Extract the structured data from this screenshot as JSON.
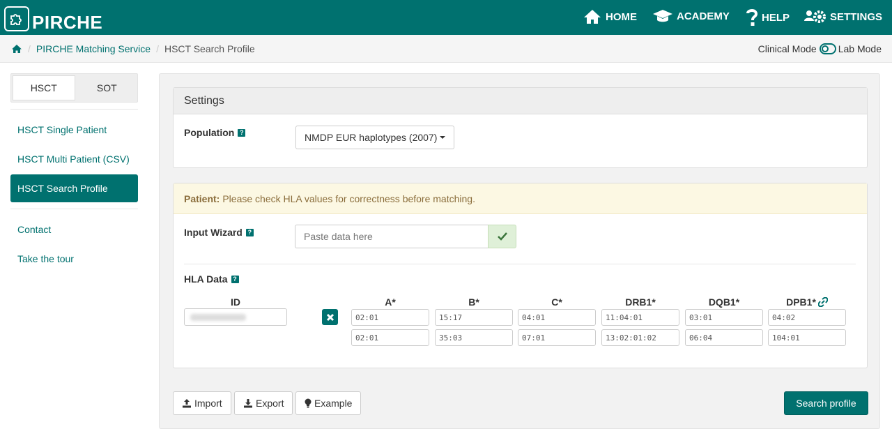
{
  "brand": {
    "name": "PIRCHE",
    "logo_icon": "puzzle-icon"
  },
  "nav": [
    {
      "label": "HOME",
      "icon": "home-icon"
    },
    {
      "label": "ACADEMY",
      "icon": "graduation-cap-icon"
    },
    {
      "label": "HELP",
      "icon": "question-icon"
    },
    {
      "label": "SETTINGS",
      "icon": "users-cog-icon"
    }
  ],
  "breadcrumb": {
    "home_icon": "home-icon",
    "items": [
      "PIRCHE Matching Service",
      "HSCT Search Profile"
    ],
    "separator": "/"
  },
  "mode": {
    "left_label": "Clinical Mode",
    "right_label": "Lab Mode"
  },
  "sidebar": {
    "tabs": [
      "HSCT",
      "SOT"
    ],
    "active_tab": "HSCT",
    "links": [
      "HSCT Single Patient",
      "HSCT Multi Patient (CSV)",
      "HSCT Search Profile"
    ],
    "active_link": "HSCT Search Profile",
    "extra_links": [
      "Contact",
      "Take the tour"
    ]
  },
  "settings": {
    "title": "Settings",
    "population_label": "Population",
    "population_value": "NMDP EUR haplotypes (2007)"
  },
  "patient": {
    "warning_bold": "Patient:",
    "warning_text": "Please check HLA values for correctness before matching.",
    "wizard_label": "Input Wizard",
    "wizard_placeholder": "Paste data here",
    "hla_label": "HLA Data",
    "id_header": "ID",
    "columns": [
      "A*",
      "B*",
      "C*",
      "DRB1*",
      "DQB1*",
      "DPB1*"
    ],
    "row1": [
      "02:01",
      "15:17",
      "04:01",
      "11:04:01",
      "03:01",
      "04:02"
    ],
    "row2": [
      "02:01",
      "35:03",
      "07:01",
      "13:02:01:02",
      "06:04",
      "104:01"
    ]
  },
  "buttons": {
    "import": "Import",
    "export": "Export",
    "example": "Example",
    "search": "Search profile"
  },
  "colors": {
    "brand": "#00716f",
    "warning_bg": "#fcf8e3",
    "warning_text": "#8a6d3b",
    "success_bg": "#dff0d8"
  }
}
